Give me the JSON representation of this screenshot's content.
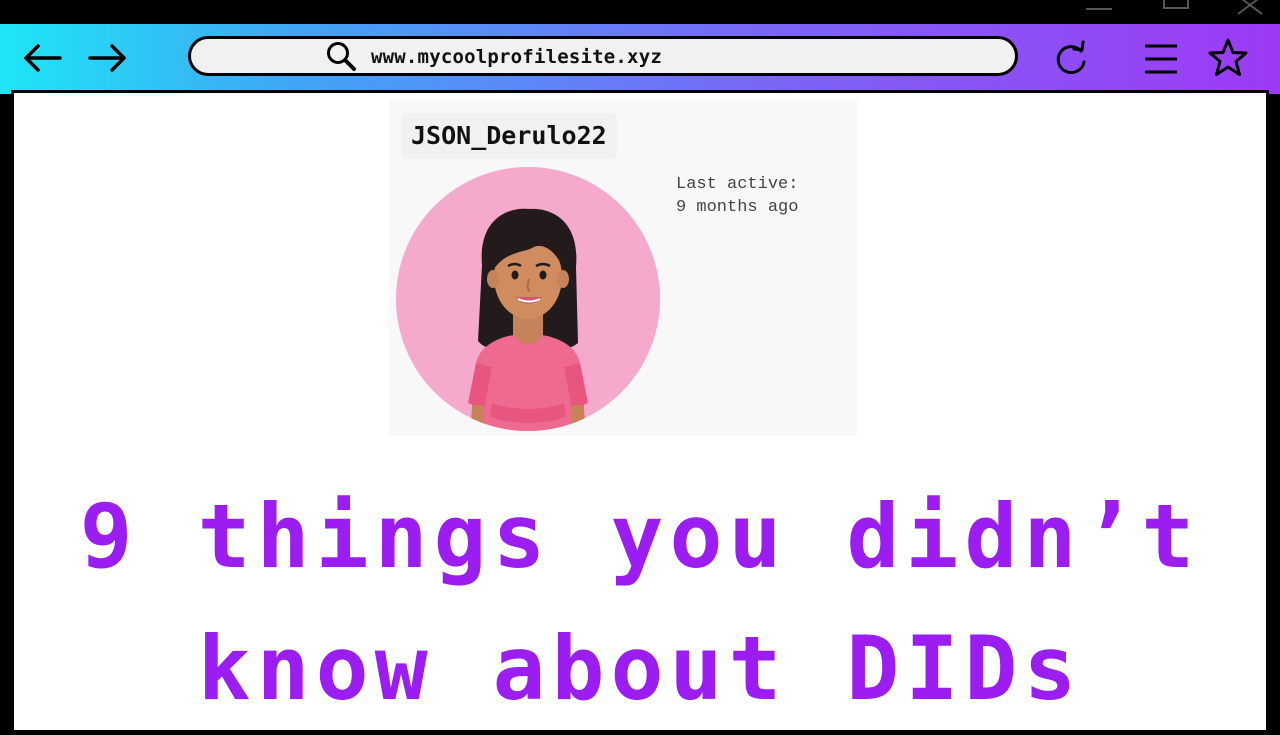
{
  "browser": {
    "url": "www.mycoolprofilesite.xyz",
    "icons": {
      "back": "arrow-left-icon",
      "forward": "arrow-right-icon",
      "search": "search-icon",
      "reload": "reload-icon",
      "menu": "hamburger-menu-icon",
      "bookmark": "star-icon"
    },
    "gradient": [
      "#1ee6f5",
      "#9d3af5"
    ]
  },
  "profile": {
    "username": "JSON_Derulo22",
    "last_active_label": "Last active:",
    "last_active_value": "9 months ago",
    "avatar_background": "#f5a9cc"
  },
  "article": {
    "headline_line1": "9 things you didn’t",
    "headline_line2": "know about DIDs",
    "headline_color": "#9b1df2"
  }
}
